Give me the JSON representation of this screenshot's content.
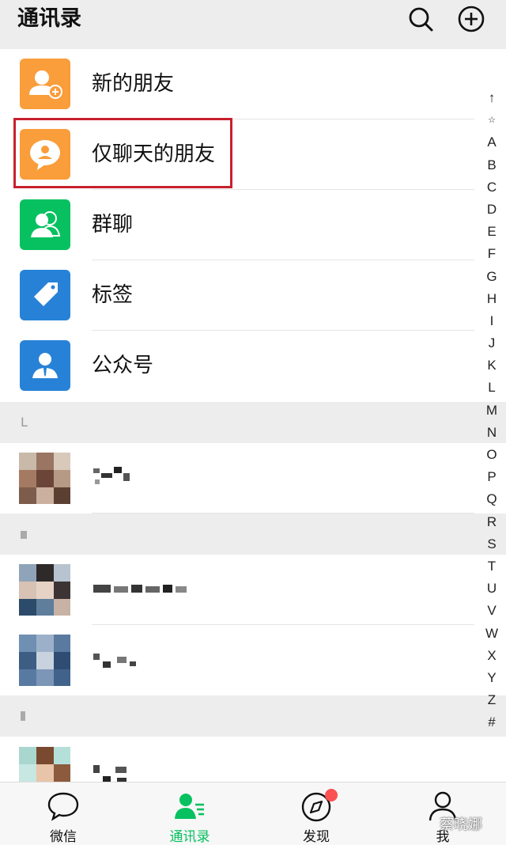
{
  "header": {
    "title": "通讯录",
    "search_icon": "search-icon",
    "add_icon": "plus-circle-icon"
  },
  "entries": [
    {
      "label": "新的朋友",
      "icon": "add-friend-icon",
      "color": "#fa9d3b"
    },
    {
      "label": "仅聊天的朋友",
      "icon": "chat-only-friend-icon",
      "color": "#fa9d3b"
    },
    {
      "label": "群聊",
      "icon": "group-chat-icon",
      "color": "#07c160"
    },
    {
      "label": "标签",
      "icon": "tag-icon",
      "color": "#2782d7"
    },
    {
      "label": "公众号",
      "icon": "official-account-icon",
      "color": "#2782d7"
    }
  ],
  "sections": [
    {
      "label": "L"
    },
    {
      "label": ""
    },
    {
      "label": ""
    }
  ],
  "index_bar": [
    "↑",
    "☆",
    "A",
    "B",
    "C",
    "D",
    "E",
    "F",
    "G",
    "H",
    "I",
    "J",
    "K",
    "L",
    "M",
    "N",
    "O",
    "P",
    "Q",
    "R",
    "S",
    "T",
    "U",
    "V",
    "W",
    "X",
    "Y",
    "Z",
    "#"
  ],
  "tabs": [
    {
      "label": "微信",
      "icon": "chat-bubble-icon",
      "active": false
    },
    {
      "label": "通讯录",
      "icon": "contacts-icon",
      "active": true
    },
    {
      "label": "发现",
      "icon": "compass-icon",
      "active": false,
      "badge": true
    },
    {
      "label": "我",
      "icon": "person-icon",
      "active": false
    }
  ],
  "watermark": "蔡晓娜",
  "colors": {
    "accent": "#07c160",
    "highlight_box": "#c8202d",
    "badge": "#fa5151"
  }
}
